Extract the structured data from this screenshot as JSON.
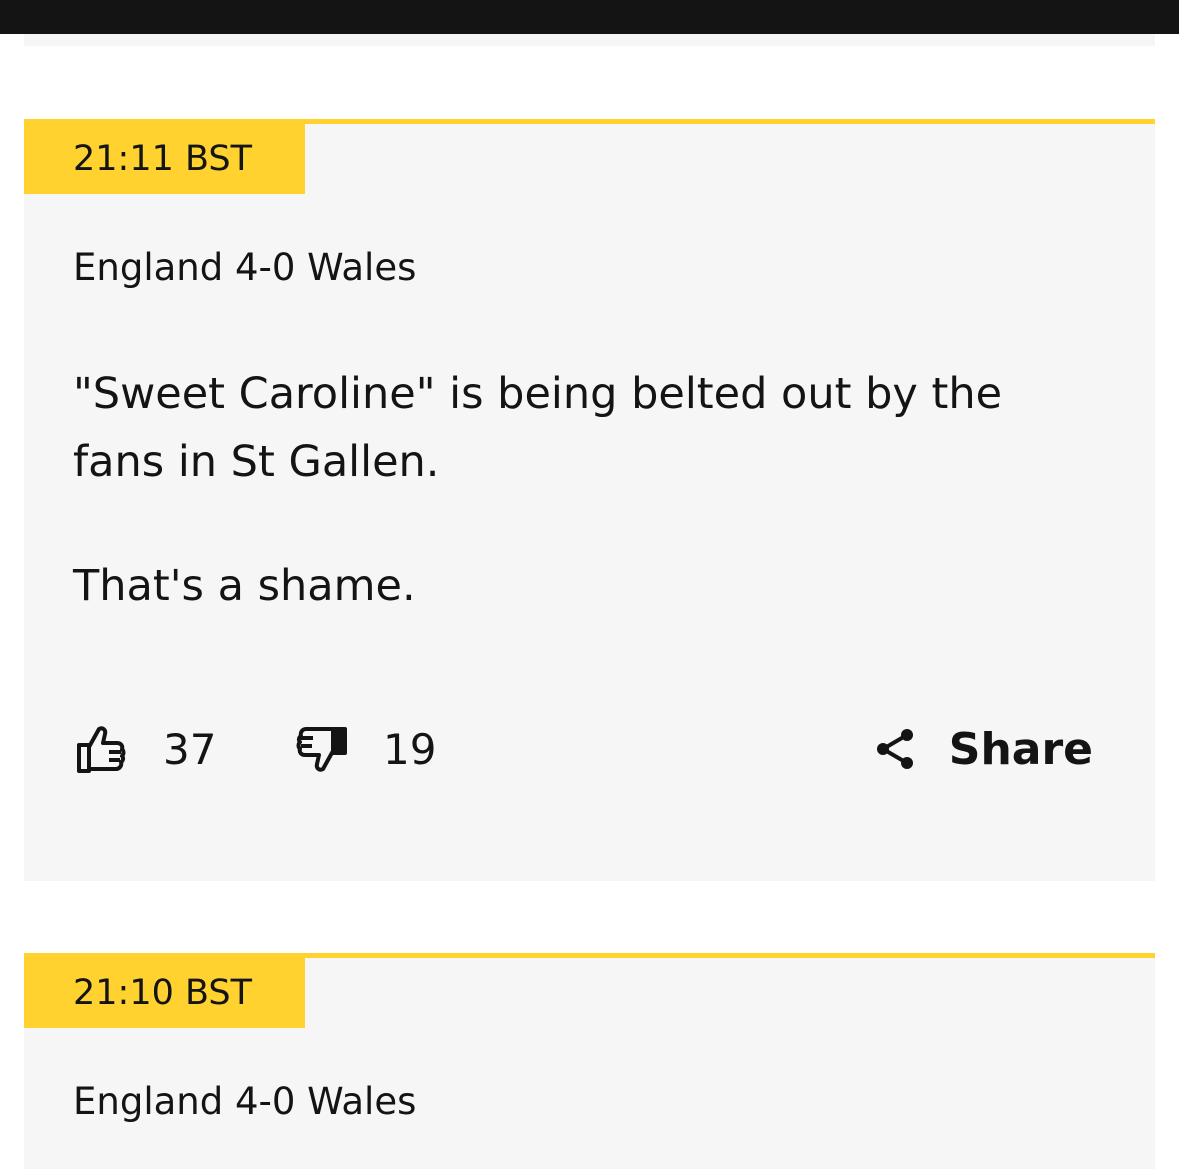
{
  "posts": [
    {
      "time": "21:11 BST",
      "title": "England 4-0 Wales",
      "paragraphs": [
        "\"Sweet Caroline\" is being belted out by the fans in St Gallen.",
        "That's a shame."
      ],
      "likes": "37",
      "dislikes": "19",
      "share_label": "Share"
    },
    {
      "time": "21:10 BST",
      "title": "England 4-0 Wales"
    }
  ],
  "colors": {
    "accent": "#ffd230",
    "card_bg": "#f6f6f6",
    "text": "#141414"
  },
  "icons": {
    "like": "thumbs-up-icon",
    "dislike": "thumbs-down-icon",
    "share": "share-icon"
  }
}
